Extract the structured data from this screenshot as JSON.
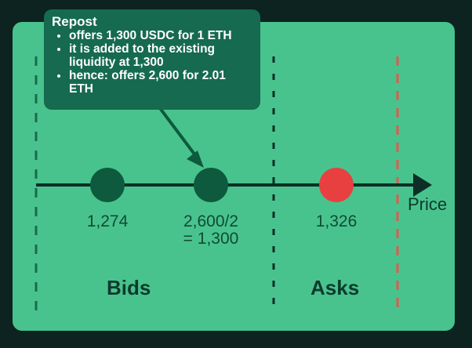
{
  "callout": {
    "title": "Repost",
    "bullets": [
      "offers 1,300 USDC for 1 ETH",
      "it is added to the existing liquidity at 1,300",
      "hence: offers 2,600 for 2.01 ETH"
    ]
  },
  "axis": {
    "label": "Price"
  },
  "points": [
    {
      "label": "1,274",
      "color": "#0d5a3e"
    },
    {
      "label_line1": "2,600/2",
      "label_line2": "= 1,300",
      "color": "#0d5a3e"
    },
    {
      "label": "1,326",
      "color": "#e84040"
    }
  ],
  "sections": {
    "bids": "Bids",
    "asks": "Asks"
  },
  "colors": {
    "panel": "#49c38d",
    "callout": "#166a4f",
    "axis": "#0c2e26",
    "bids_boundary": "#1a6b4f",
    "mid_divider": "#0c2e26",
    "asks_boundary": "#e05a4e"
  }
}
